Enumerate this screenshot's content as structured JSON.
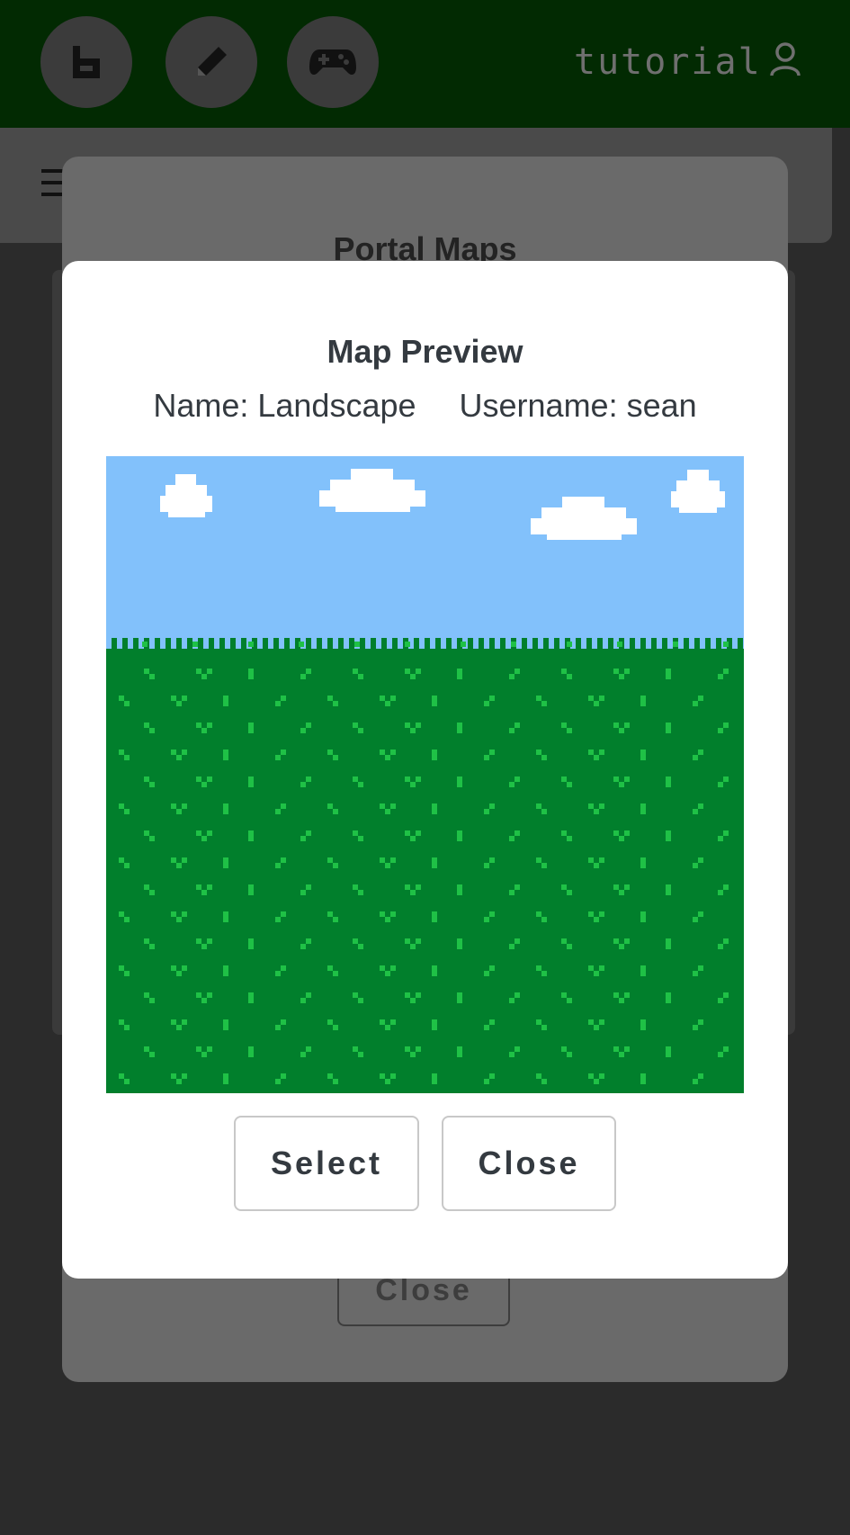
{
  "nav": {
    "username": "tutorial",
    "buttons": [
      {
        "icon": "b-logo-icon"
      },
      {
        "icon": "pencil-icon"
      },
      {
        "icon": "gamepad-icon"
      }
    ],
    "user_icon": "user-icon"
  },
  "background_modal": {
    "title": "Portal Maps",
    "close_label": "Close"
  },
  "preview_modal": {
    "title": "Map Preview",
    "name": "Name: Landscape",
    "username": "Username: sean",
    "map_name": "Landscape",
    "select_label": "Select",
    "close_label": "Close"
  },
  "colors": {
    "sky": "#82c1fb",
    "grass": "#017f2c",
    "grass_light": "#1fc146",
    "cloud": "#ffffff",
    "nav_bar": "#022a02"
  }
}
